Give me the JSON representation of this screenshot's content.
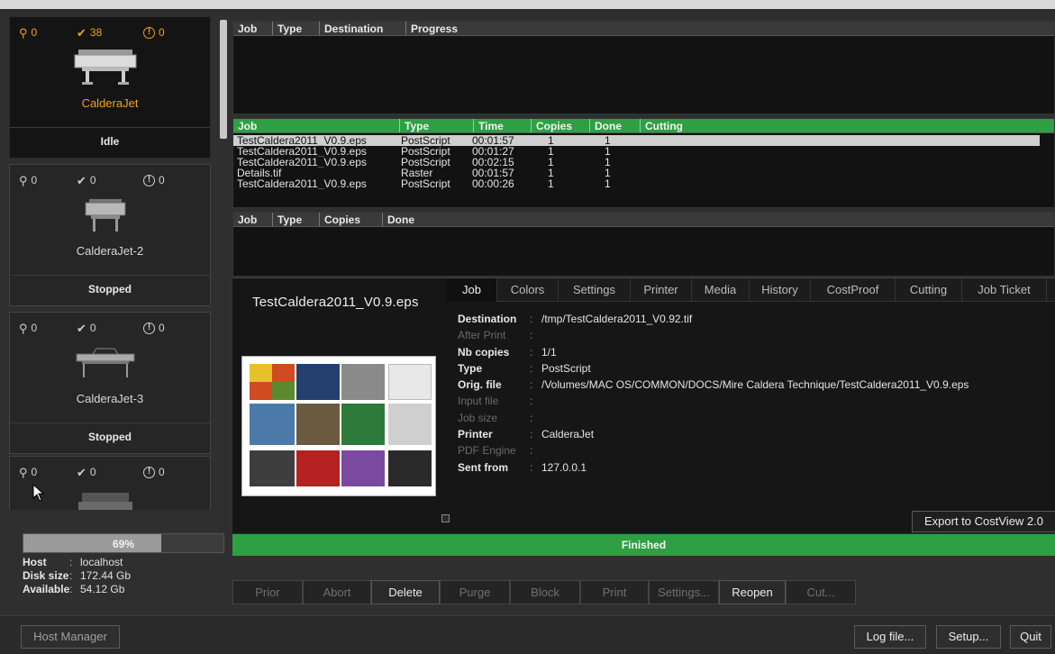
{
  "printers": [
    {
      "name": "CalderaJet",
      "status": "Idle",
      "counts": {
        "pending": "0",
        "done": "38",
        "warnings": "0"
      },
      "selected": true
    },
    {
      "name": "CalderaJet-2",
      "status": "Stopped",
      "counts": {
        "pending": "0",
        "done": "0",
        "warnings": "0"
      },
      "selected": false
    },
    {
      "name": "CalderaJet-3",
      "status": "Stopped",
      "counts": {
        "pending": "0",
        "done": "0",
        "warnings": "0"
      },
      "selected": false
    },
    {
      "name": "",
      "status": "",
      "counts": {
        "pending": "0",
        "done": "0",
        "warnings": "0"
      },
      "selected": false
    }
  ],
  "disk": {
    "percent_label": "69%",
    "fraction": 0.69
  },
  "host_info": {
    "host_label": "Host",
    "host": "localhost",
    "disk_label": "Disk size",
    "disk": "172.44 Gb",
    "avail_label": "Available",
    "avail": "54.12 Gb"
  },
  "queue_table": {
    "headers": [
      "Job",
      "Type",
      "Destination",
      "Progress"
    ]
  },
  "history_table": {
    "headers": [
      "Job",
      "Type",
      "Time",
      "Copies",
      "Done",
      "Cutting"
    ],
    "rows": [
      [
        "TestCaldera2011_V0.9.eps",
        "PostScript",
        "00:01:57",
        "1",
        "1",
        ""
      ],
      [
        "TestCaldera2011_V0.9.eps",
        "PostScript",
        "00:01:27",
        "1",
        "1",
        ""
      ],
      [
        "TestCaldera2011_V0.9.eps",
        "PostScript",
        "00:02:15",
        "1",
        "1",
        ""
      ],
      [
        "Details.tif",
        "Raster",
        "00:01:57",
        "1",
        "1",
        ""
      ],
      [
        "TestCaldera2011_V0.9.eps",
        "PostScript",
        "00:00:26",
        "1",
        "1",
        ""
      ]
    ]
  },
  "hold_table": {
    "headers": [
      "Job",
      "Type",
      "Copies",
      "Done"
    ]
  },
  "detail": {
    "job_title": "TestCaldera2011_V0.9.eps",
    "tabs": [
      "Job",
      "Colors",
      "Settings",
      "Printer",
      "Media",
      "History",
      "CostProof",
      "Cutting",
      "Job Ticket"
    ],
    "active_tab": "Job",
    "properties": [
      {
        "label": "Destination",
        "value": "/tmp/TestCaldera2011_V0.92.tif",
        "dim": false
      },
      {
        "label": "After Print",
        "value": "",
        "dim": true
      },
      {
        "label": "Nb copies",
        "value": "1/1",
        "dim": false
      },
      {
        "label": "Type",
        "value": "PostScript",
        "dim": false
      },
      {
        "label": "Orig. file",
        "value": "/Volumes/MAC OS/COMMON/DOCS/Mire Caldera Technique/TestCaldera2011_V0.9.eps",
        "dim": false
      },
      {
        "label": "Input file",
        "value": "",
        "dim": true
      },
      {
        "label": "Job size",
        "value": "",
        "dim": true
      },
      {
        "label": "Printer",
        "value": "CalderaJet",
        "dim": false
      },
      {
        "label": "PDF Engine",
        "value": "",
        "dim": true
      },
      {
        "label": "Sent from",
        "value": "127.0.0.1",
        "dim": false
      }
    ],
    "export_label": "Export to CostView 2.0"
  },
  "status_bar": {
    "label": "Finished",
    "color": "#2ea043"
  },
  "actions": [
    {
      "label": "Prior",
      "enabled": false
    },
    {
      "label": "Abort",
      "enabled": false
    },
    {
      "label": "Delete",
      "enabled": true
    },
    {
      "label": "Purge",
      "enabled": false
    },
    {
      "label": "Block",
      "enabled": false
    },
    {
      "label": "Print",
      "enabled": false
    },
    {
      "label": "Settings...",
      "enabled": false
    },
    {
      "label": "Reopen",
      "enabled": true
    },
    {
      "label": "Cut...",
      "enabled": false
    }
  ],
  "bottom": {
    "host_manager": "Host Manager",
    "log_file": "Log file...",
    "setup": "Setup...",
    "quit": "Quit"
  },
  "colors": {
    "accent_orange": "#f0a020",
    "status_green": "#2ea043"
  },
  "icons": [
    "key-icon",
    "check-icon",
    "warning-icon",
    "printer-icon",
    "cursor-icon"
  ]
}
